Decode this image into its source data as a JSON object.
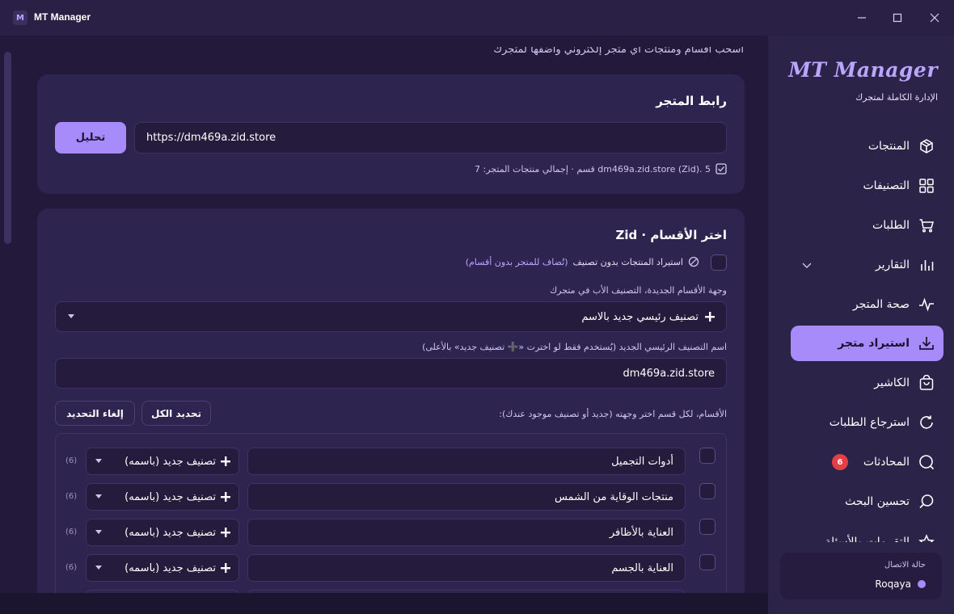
{
  "titlebar": {
    "logo_text": "M",
    "title": "MT Manager",
    "minimize": "—",
    "maximize": "☐",
    "close": "✕"
  },
  "main": {
    "cut_text": "اسحب أقسام ومنتجات أي متجر إلكتروني وأضفها لمتجرك",
    "store_link": {
      "title": "رابط المتجر",
      "url_value": "https://dm469a.zid.store",
      "analyze_label": "تحليل",
      "summary": "dm469a.zid.store (Zid). 5 قسم · إجمالي منتجات المتجر: 7"
    },
    "sections": {
      "title": "اختر الأقسام · Zid",
      "no_category_label": "استيراد المنتجات بدون تصنيف",
      "no_category_hint": "(تُضاف للمتجر بدون أقسام)",
      "destination_label": "وجهة الأقسام الجديدة، التصنيف الأب في متجرك",
      "destination_value": "تصنيف رئيسي جديد بالاسم",
      "new_name_label": "اسم التصنيف الرئيسي الجديد (يُستخدم فقط لو اخترت «➕ تصنيف جديد» بالأعلى)",
      "new_name_value": "dm469a.zid.store",
      "select_all_label": "تحديد الكل",
      "deselect_label": "إلغاء التحديد",
      "list_hint": "الأقسام، لكل قسم اختر وجهته (جديد أو تصنيف موجود عندك):",
      "rows": [
        {
          "name": "أدوات التجميل",
          "dest": "تصنيف جديد (باسمه)",
          "count": "(6)"
        },
        {
          "name": "منتجات الوقاية من الشمس",
          "dest": "تصنيف جديد (باسمه)",
          "count": "(6)"
        },
        {
          "name": "العناية بالأظافر",
          "dest": "تصنيف جديد (باسمه)",
          "count": "(6)"
        },
        {
          "name": "العناية بالجسم",
          "dest": "تصنيف جديد (باسمه)",
          "count": "(6)"
        }
      ]
    }
  },
  "sidebar": {
    "brand": "MT Manager",
    "brand_sub": "الإدارة الكاملة لمتجرك",
    "items": [
      {
        "label": "المنتجات",
        "icon": "box-icon"
      },
      {
        "label": "التصنيفات",
        "icon": "grid-icon"
      },
      {
        "label": "الطلبات",
        "icon": "cart-icon"
      },
      {
        "label": "التقارير",
        "icon": "chart-icon"
      },
      {
        "label": "صحة المتجر",
        "icon": "pulse-icon"
      },
      {
        "label": "استيراد متجر",
        "icon": "download-icon"
      },
      {
        "label": "الكاشير",
        "icon": "bag-icon"
      },
      {
        "label": "استرجاع الطلبات",
        "icon": "refresh-icon"
      },
      {
        "label": "المحادثات",
        "icon": "chat-icon",
        "badge": "6"
      },
      {
        "label": "تحسين البحث",
        "icon": "search-icon"
      },
      {
        "label": "التقييمات والأسئلة",
        "icon": "star-icon"
      }
    ],
    "status": {
      "title": "حالة الاتصال",
      "user": "Roqaya",
      "dot_color": "#a78bfa"
    }
  }
}
